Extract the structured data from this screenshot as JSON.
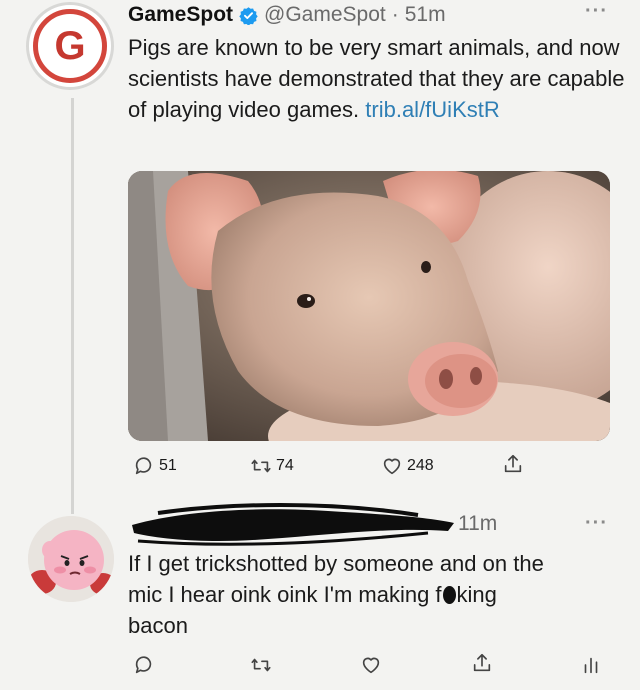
{
  "tweet": {
    "display_name": "GameSpot",
    "handle": "@GameSpot",
    "separator": "·",
    "time": "51m",
    "text": "Pigs are known to be very smart animals, and now scientists have demonstrated that they are capable of playing video games.",
    "link": "trib.al/fUiKstR",
    "avatar_letter": "G",
    "replies": "51",
    "retweets": "74",
    "likes": "248"
  },
  "reply": {
    "time": "11m",
    "line1": "If I get trickshotted by someone and on the",
    "line2_before": "mic I hear oink oink I'm making f",
    "line2_after": "king",
    "line3": "bacon"
  },
  "icons": [
    "verified-icon",
    "more-icon",
    "reply-icon",
    "retweet-icon",
    "like-icon",
    "share-icon",
    "analytics-icon"
  ],
  "colors": {
    "link": "#2f7fb5",
    "gamespot_red": "#d3463c",
    "verified": "#1d9bf0"
  }
}
